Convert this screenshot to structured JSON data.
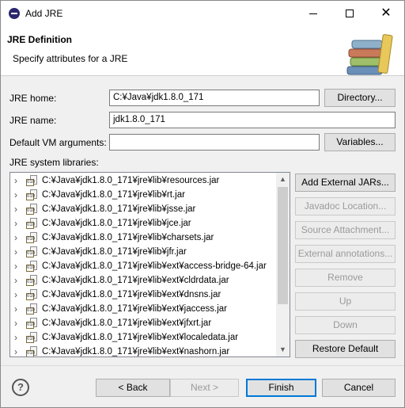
{
  "window": {
    "title": "Add JRE",
    "minimize_glyph": "",
    "close_glyph": "✕"
  },
  "header": {
    "title": "JRE Definition",
    "description": "Specify attributes for a JRE"
  },
  "form": {
    "jre_home_label": "JRE home:",
    "jre_home_value": "C:¥Java¥jdk1.8.0_171",
    "directory_button": "Directory...",
    "jre_name_label": "JRE name:",
    "jre_name_value": "jdk1.8.0_171",
    "vm_args_label": "Default VM arguments:",
    "vm_args_value": "",
    "variables_button": "Variables...",
    "libraries_label": "JRE system libraries:"
  },
  "libraries": [
    "C:¥Java¥jdk1.8.0_171¥jre¥lib¥resources.jar",
    "C:¥Java¥jdk1.8.0_171¥jre¥lib¥rt.jar",
    "C:¥Java¥jdk1.8.0_171¥jre¥lib¥jsse.jar",
    "C:¥Java¥jdk1.8.0_171¥jre¥lib¥jce.jar",
    "C:¥Java¥jdk1.8.0_171¥jre¥lib¥charsets.jar",
    "C:¥Java¥jdk1.8.0_171¥jre¥lib¥jfr.jar",
    "C:¥Java¥jdk1.8.0_171¥jre¥lib¥ext¥access-bridge-64.jar",
    "C:¥Java¥jdk1.8.0_171¥jre¥lib¥ext¥cldrdata.jar",
    "C:¥Java¥jdk1.8.0_171¥jre¥lib¥ext¥dnsns.jar",
    "C:¥Java¥jdk1.8.0_171¥jre¥lib¥ext¥jaccess.jar",
    "C:¥Java¥jdk1.8.0_171¥jre¥lib¥ext¥jfxrt.jar",
    "C:¥Java¥jdk1.8.0_171¥jre¥lib¥ext¥localedata.jar",
    "C:¥Java¥jdk1.8.0_171¥jre¥lib¥ext¥nashorn.jar"
  ],
  "side_buttons": {
    "add_external_jars": "Add External JARs...",
    "javadoc_location": "Javadoc Location...",
    "source_attachment": "Source Attachment...",
    "external_annotations": "External annotations...",
    "remove": "Remove",
    "up": "Up",
    "down": "Down",
    "restore_default": "Restore Default"
  },
  "footer": {
    "help": "?",
    "back": "< Back",
    "next": "Next >",
    "finish": "Finish",
    "cancel": "Cancel"
  },
  "icons": {
    "app": "eclipse-icon",
    "banner": "books-icon",
    "jar": "jar-file-icon",
    "expand": "chevron-right-icon"
  }
}
